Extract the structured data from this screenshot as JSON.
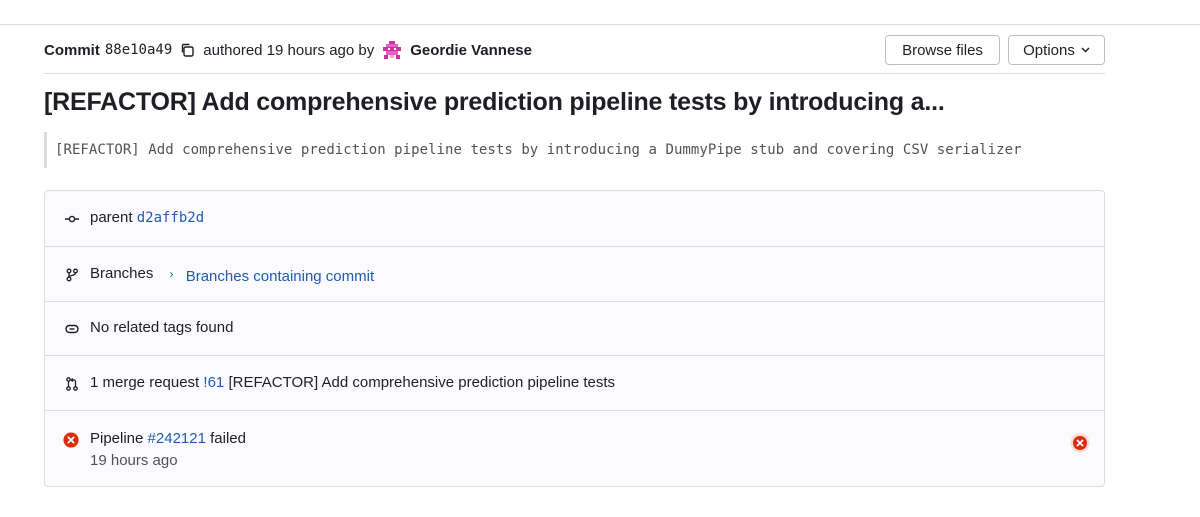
{
  "commit": {
    "label": "Commit",
    "sha": "88e10a49",
    "authored_text": "authored 19 hours ago by",
    "author": "Geordie Vannese",
    "title": "[REFACTOR] Add comprehensive prediction pipeline tests by introducing a...",
    "description": "[REFACTOR] Add comprehensive prediction pipeline tests by introducing a DummyPipe stub and covering CSV serializer"
  },
  "toolbar": {
    "browse_files_label": "Browse files",
    "options_label": "Options"
  },
  "info": {
    "parent_label": "parent",
    "parent_sha": "d2affb2d",
    "branches_label": "Branches",
    "branches_link": "Branches containing commit",
    "tags_text": "No related tags found",
    "mr_text": "1 merge request",
    "mr_link": "!61",
    "mr_title": "[REFACTOR] Add comprehensive prediction pipeline tests",
    "pipeline_label": "Pipeline",
    "pipeline_link": "#242121",
    "pipeline_status": "failed",
    "pipeline_time": "19 hours ago"
  },
  "colors": {
    "link": "#1f5bb5",
    "failed": "#dd2b0e",
    "border": "#dcdcde"
  },
  "icons": [
    "copy-icon",
    "avatar",
    "commit-icon",
    "branch-icon",
    "tag-icon",
    "merge-request-icon",
    "status-failed-icon"
  ]
}
